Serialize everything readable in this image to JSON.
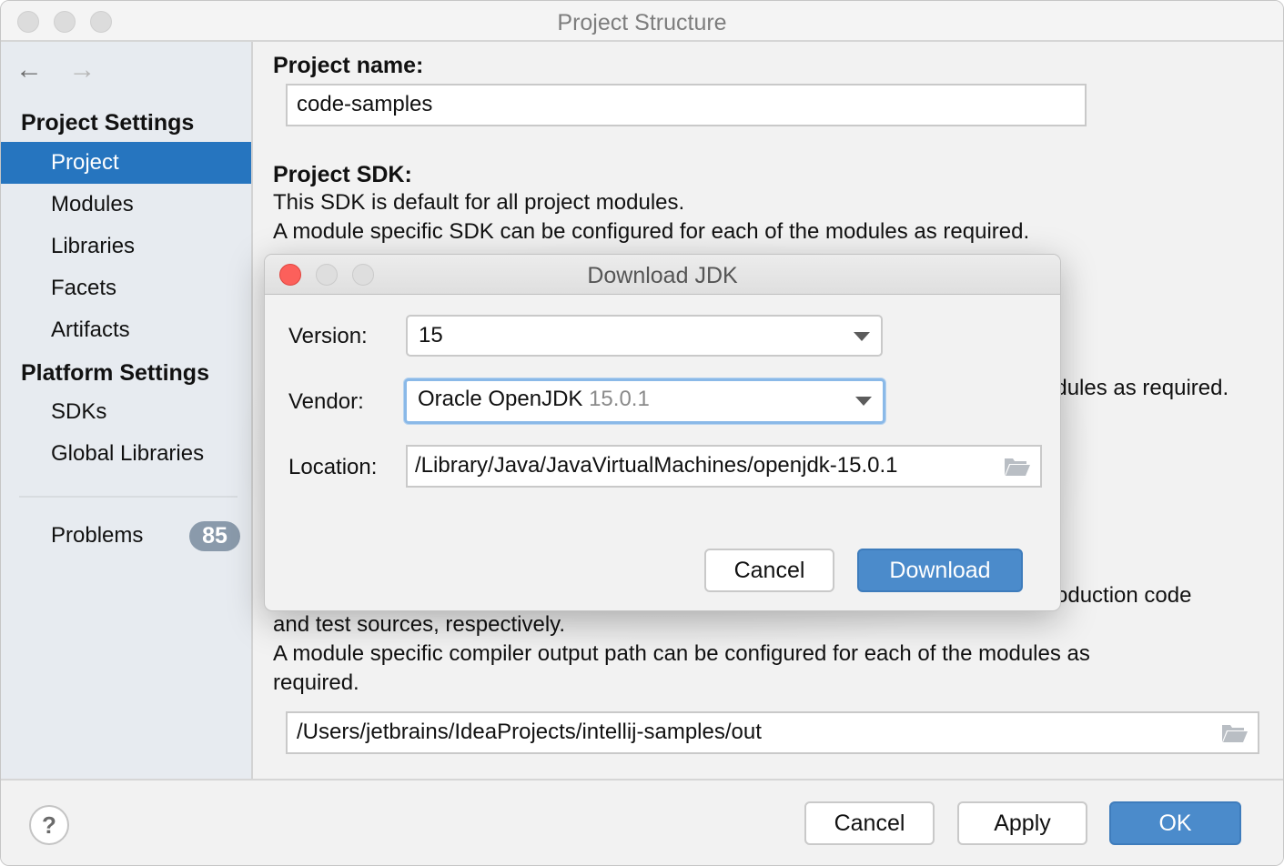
{
  "window": {
    "title": "Project Structure"
  },
  "sidebar": {
    "nav": {
      "back_icon": "arrow-left-icon",
      "forward_icon": "arrow-right-icon"
    },
    "sections": [
      {
        "heading": "Project Settings",
        "items": [
          {
            "label": "Project",
            "selected": true
          },
          {
            "label": "Modules"
          },
          {
            "label": "Libraries"
          },
          {
            "label": "Facets"
          },
          {
            "label": "Artifacts"
          }
        ]
      },
      {
        "heading": "Platform Settings",
        "items": [
          {
            "label": "SDKs"
          },
          {
            "label": "Global Libraries"
          }
        ]
      }
    ],
    "problems": {
      "label": "Problems",
      "count": "85"
    }
  },
  "content": {
    "project_name_label": "Project name:",
    "project_name_value": "code-samples",
    "project_sdk_label": "Project SDK:",
    "sdk_desc_1": "This SDK is default for all project modules.",
    "sdk_desc_2": "A module specific SDK can be configured for each of the modules as required.",
    "partial_lang_level_text": "odules as required.",
    "partial_compiler_text": "oduction code",
    "compiler_desc_1": "and test sources, respectively.",
    "compiler_desc_2": "A module specific compiler output path can be configured for each of the modules as",
    "compiler_desc_3": "required.",
    "compiler_output_value": "/Users/jetbrains/IdeaProjects/intellij-samples/out"
  },
  "dialog": {
    "title": "Download JDK",
    "version_label": "Version:",
    "version_value": "15",
    "vendor_label": "Vendor:",
    "vendor_value": "Oracle OpenJDK",
    "vendor_version": "15.0.1",
    "location_label": "Location:",
    "location_value": "/Library/Java/JavaVirtualMachines/openjdk-15.0.1",
    "cancel_label": "Cancel",
    "download_label": "Download"
  },
  "footer": {
    "help_label": "?",
    "cancel_label": "Cancel",
    "apply_label": "Apply",
    "ok_label": "OK"
  },
  "colors": {
    "accent": "#2675bf",
    "primary_button": "#4b8bcb",
    "badge": "#8a9aab",
    "close_button": "#fc605b"
  }
}
